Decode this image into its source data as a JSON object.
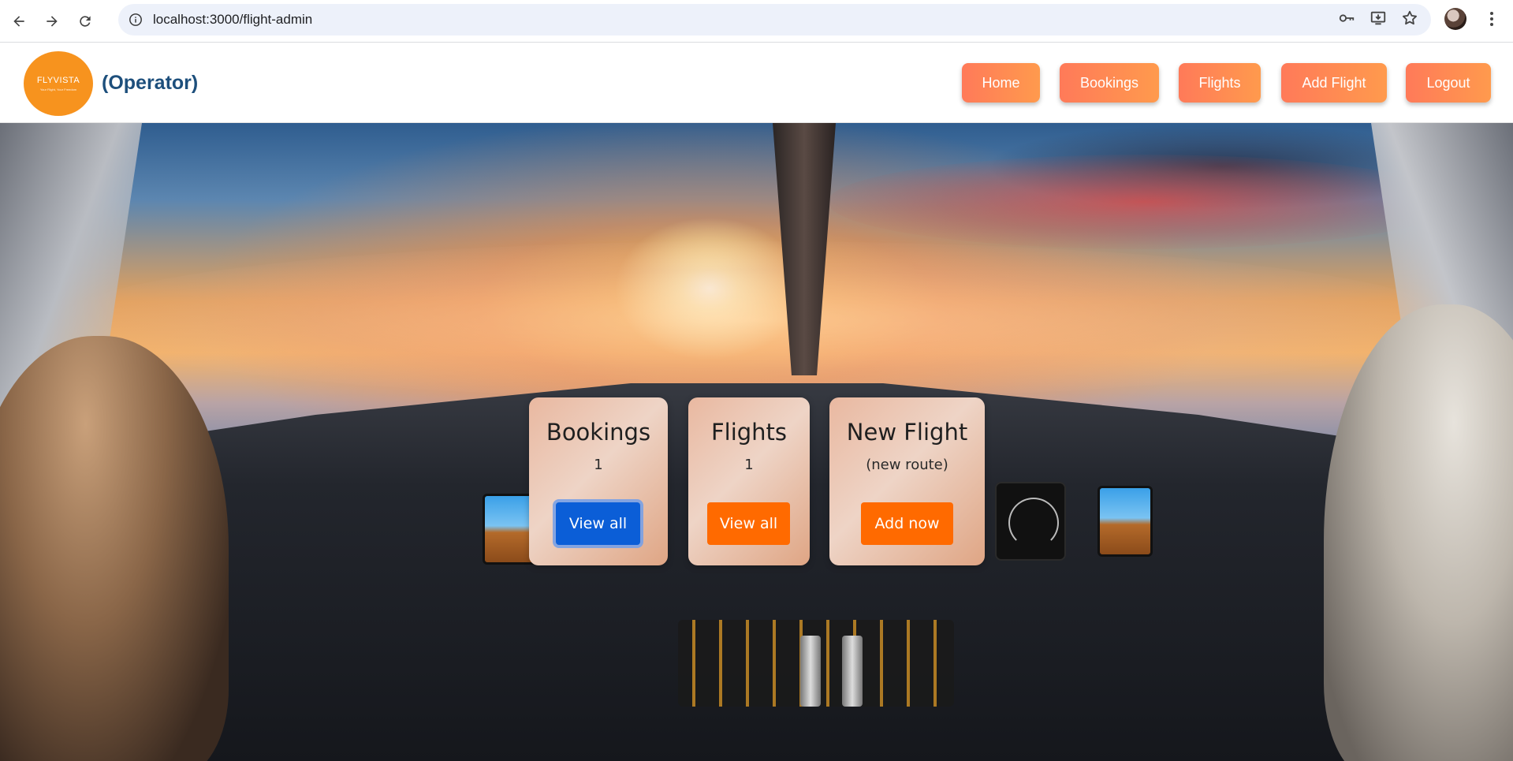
{
  "browser": {
    "url": "localhost:3000/flight-admin"
  },
  "header": {
    "logo": {
      "brand": "FLYVISTA",
      "tagline": "Your Flight, Your Freedom"
    },
    "role": "(Operator)",
    "nav": [
      {
        "label": "Home"
      },
      {
        "label": "Bookings"
      },
      {
        "label": "Flights"
      },
      {
        "label": "Add Flight"
      },
      {
        "label": "Logout"
      }
    ]
  },
  "cards": [
    {
      "title": "Bookings",
      "value": "1",
      "button": "View all"
    },
    {
      "title": "Flights",
      "value": "1",
      "button": "View all"
    },
    {
      "title": "New Flight",
      "value": "(new route)",
      "button": "Add now"
    }
  ],
  "colors": {
    "accent_orange": "#ff6a00",
    "active_blue": "#0b5ed7",
    "nav_gradient_start": "#ff7a59",
    "nav_gradient_end": "#ff9a4d",
    "role_text": "#1d4f7c"
  }
}
